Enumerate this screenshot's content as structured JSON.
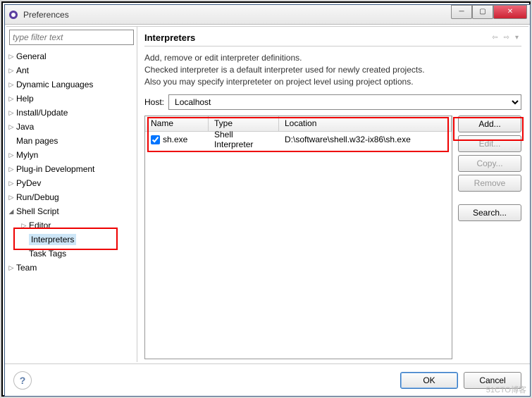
{
  "window": {
    "title": "Preferences"
  },
  "filter": {
    "placeholder": "type filter text"
  },
  "tree": [
    {
      "label": "General",
      "expandable": true
    },
    {
      "label": "Ant",
      "expandable": true
    },
    {
      "label": "Dynamic Languages",
      "expandable": true
    },
    {
      "label": "Help",
      "expandable": true
    },
    {
      "label": "Install/Update",
      "expandable": true
    },
    {
      "label": "Java",
      "expandable": true
    },
    {
      "label": "Man pages",
      "expandable": false
    },
    {
      "label": "Mylyn",
      "expandable": true
    },
    {
      "label": "Plug-in Development",
      "expandable": true
    },
    {
      "label": "PyDev",
      "expandable": true
    },
    {
      "label": "Run/Debug",
      "expandable": true
    },
    {
      "label": "Shell Script",
      "expandable": true,
      "expanded": true,
      "children": [
        {
          "label": "Editor",
          "expandable": true
        },
        {
          "label": "Interpreters",
          "selected": true
        },
        {
          "label": "Task Tags"
        }
      ]
    },
    {
      "label": "Team",
      "expandable": true
    }
  ],
  "page": {
    "title": "Interpreters",
    "desc1": "Add, remove or edit interpreter definitions.",
    "desc2": "Checked interpreter is a default interpreter used for newly created projects.",
    "desc3": "Also you may specify interpreteter on project level using project options.",
    "host_label": "Host:",
    "host_value": "Localhost"
  },
  "table": {
    "cols": {
      "name": "Name",
      "type": "Type",
      "location": "Location"
    },
    "rows": [
      {
        "checked": true,
        "name": "sh.exe",
        "type": "Shell Interpreter",
        "location": "D:\\software\\shell.w32-ix86\\sh.exe"
      }
    ]
  },
  "buttons": {
    "add": "Add...",
    "edit": "Edit...",
    "copy": "Copy...",
    "remove": "Remove",
    "search": "Search..."
  },
  "footer": {
    "ok": "OK",
    "cancel": "Cancel"
  },
  "watermark": "51CTO博客"
}
